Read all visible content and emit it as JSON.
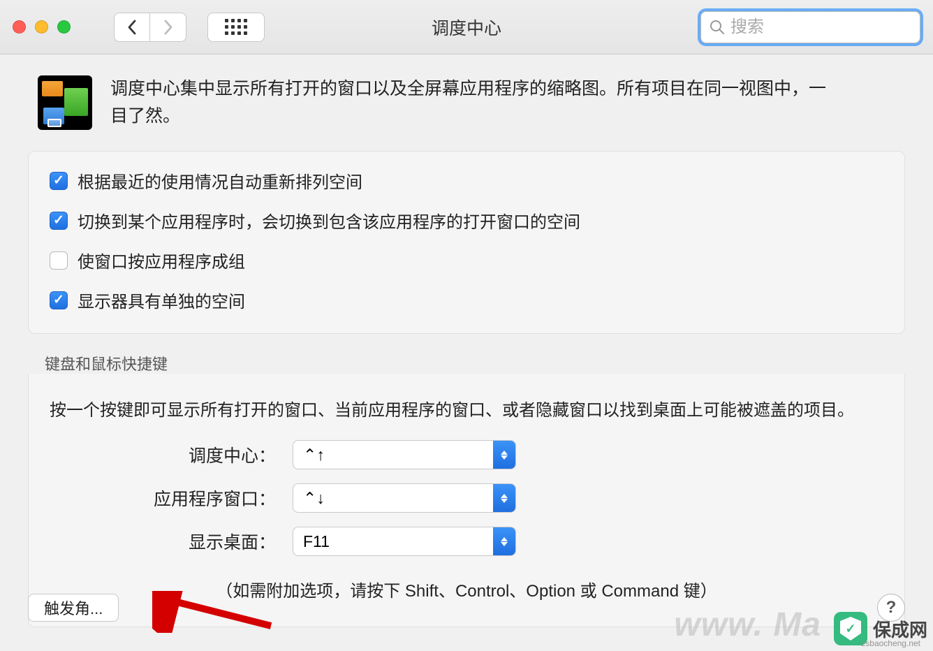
{
  "window": {
    "title": "调度中心"
  },
  "search": {
    "placeholder": "搜索"
  },
  "intro": "调度中心集中显示所有打开的窗口以及全屏幕应用程序的缩略图。所有项目在同一视图中，一目了然。",
  "options": [
    {
      "label": "根据最近的使用情况自动重新排列空间",
      "checked": true
    },
    {
      "label": "切换到某个应用程序时，会切换到包含该应用程序的打开窗口的空间",
      "checked": true
    },
    {
      "label": "使窗口按应用程序成组",
      "checked": false
    },
    {
      "label": "显示器具有单独的空间",
      "checked": true
    }
  ],
  "keyboard": {
    "header": "键盘和鼠标快捷键",
    "desc": "按一个按键即可显示所有打开的窗口、当前应用程序的窗口、或者隐藏窗口以找到桌面上可能被遮盖的项目。",
    "rows": [
      {
        "label": "调度中心：",
        "value": "⌃↑"
      },
      {
        "label": "应用程序窗口：",
        "value": "⌃↓"
      },
      {
        "label": "显示桌面：",
        "value": "F11"
      }
    ],
    "hint": "（如需附加选项，请按下 Shift、Control、Option 或 Command 键）"
  },
  "footer": {
    "hotCorners": "触发角..."
  },
  "watermark": {
    "brand": "保成网",
    "sub": "zsbaocheng.net",
    "bg": "www. Ma"
  }
}
